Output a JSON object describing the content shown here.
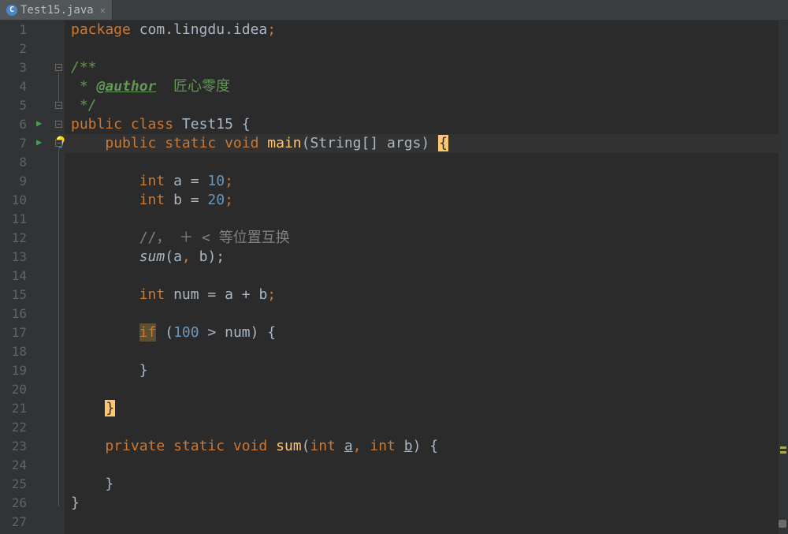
{
  "tab": {
    "filename": "Test15.java",
    "icon_letter": "C"
  },
  "gutter": {
    "lines": [
      "1",
      "2",
      "3",
      "4",
      "5",
      "6",
      "7",
      "8",
      "9",
      "10",
      "11",
      "12",
      "13",
      "14",
      "15",
      "16",
      "17",
      "18",
      "19",
      "20",
      "21",
      "22",
      "23",
      "24",
      "25",
      "26",
      "27"
    ]
  },
  "code": {
    "l1": {
      "kw_package": "package ",
      "pkg": "com.lingdu.idea",
      "semi": ";"
    },
    "l3": {
      "doc": "/**"
    },
    "l4": {
      "star": " * ",
      "tag": "@author",
      "author": "  匠心零度"
    },
    "l5": {
      "doc": " */"
    },
    "l6": {
      "kw_public": "public ",
      "kw_class": "class ",
      "name": "Test15",
      "brace": " {"
    },
    "l7": {
      "kw_public": "public ",
      "kw_static": "static ",
      "kw_void": "void ",
      "mth": "main",
      "open": "(",
      "type": "String",
      "arr": "[] ",
      "arg": "args",
      "close": ") ",
      "brace": "{"
    },
    "l9": {
      "kw_int": "int ",
      "var": "a",
      "eq": " = ",
      "num": "10",
      "semi": ";"
    },
    "l10": {
      "kw_int": "int ",
      "var": "b",
      "eq": " = ",
      "num": "20",
      "semi": ";"
    },
    "l12": {
      "cmt": "//， ＋ < 等位置互换"
    },
    "l13": {
      "mth": "sum",
      "open": "(",
      "a": "a",
      "comma": ", ",
      "b": "b",
      "close": ");"
    },
    "l15": {
      "kw_int": "int ",
      "var": "num",
      "eq": " = ",
      "a": "a",
      "plus": " + ",
      "b": "b",
      "semi": ";"
    },
    "l17": {
      "kw_if": "if",
      "sp": " (",
      "num": "100",
      "gt": " > ",
      "var": "num",
      "close": ") {"
    },
    "l19": {
      "brace": "}"
    },
    "l21": {
      "brace": "}"
    },
    "l23": {
      "kw_private": "private ",
      "kw_static": "static ",
      "kw_void": "void ",
      "mth": "sum",
      "open": "(",
      "kw_int1": "int ",
      "a": "a",
      "comma": ", ",
      "kw_int2": "int ",
      "b": "b",
      "close": ") {"
    },
    "l25": {
      "brace": "}"
    },
    "l26": {
      "brace": "}"
    }
  }
}
